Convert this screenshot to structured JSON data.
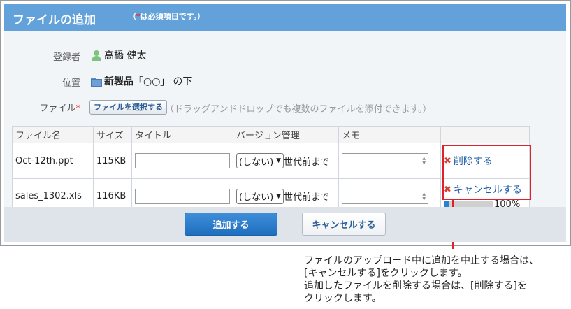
{
  "dialog": {
    "title": "ファイルの追加",
    "required_note_prefix": "（",
    "required_note_star": "*",
    "required_note_suffix": "は必須項目です。）"
  },
  "fields": {
    "registrant_label": "登録者",
    "registrant_value": "高橋 健太",
    "location_label": "位置",
    "location_value": "新製品「○○」",
    "location_suffix": "の下",
    "file_label": "ファイル",
    "file_required_star": "*",
    "select_file_button": "ファイルを選択する",
    "drop_hint": "（ドラッグアンドドロップでも複数のファイルを添付できます。）"
  },
  "table": {
    "headers": [
      "ファイル名",
      "サイズ",
      "タイトル",
      "バージョン管理",
      "メモ",
      ""
    ],
    "rows": [
      {
        "file_name": "Oct-12th.ppt",
        "size": "115KB",
        "version_option": "(しない)",
        "version_suffix": "世代前まで",
        "action_label": "削除する"
      },
      {
        "file_name": "sales_1302.xls",
        "size": "116KB",
        "version_option": "(しない)",
        "version_suffix": "世代前まで",
        "action_label": "キャンセルする",
        "progress_text": "100%",
        "progress_fill_fraction": 0.11
      }
    ]
  },
  "buttons": {
    "add": "追加する",
    "cancel": "キャンセルする"
  },
  "callout": {
    "line1": "ファイルのアップロード中に追加を中止する場合は、",
    "line2": "[キャンセルする]をクリックします。",
    "line3": "追加したファイルを削除する場合は、[削除する]を",
    "line4": "クリックします。"
  },
  "colors": {
    "title_bar": "#62a1d9",
    "primary_button": "#2f7fd0",
    "highlight": "#e0202a",
    "link": "#1a5aa8",
    "delete_x": "#d83b2f"
  },
  "icons": {
    "registrant": "user-icon",
    "location": "folder-icon",
    "delete": "x-icon",
    "cancel_upload": "x-icon",
    "version_dropdown": "chevron-down-icon",
    "memo_spinner": "spinner-icon"
  }
}
